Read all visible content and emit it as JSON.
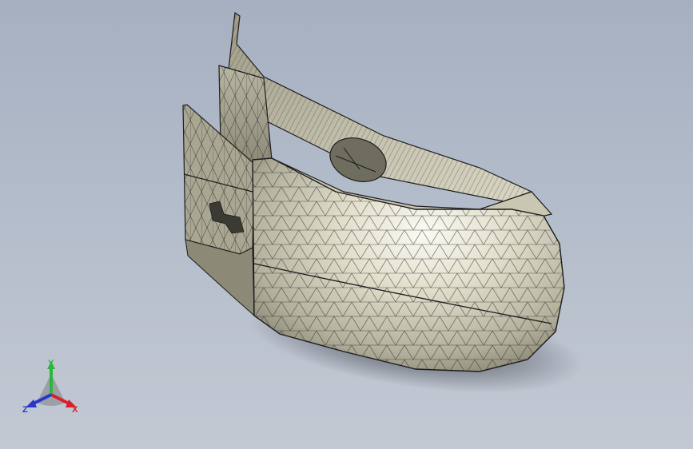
{
  "viewport": {
    "background_top": "#a6b0c1",
    "background_bottom": "#c3c9d3",
    "model_color": "#d8d5c2",
    "edge_color": "#1c1c1c"
  },
  "triad": {
    "x_label": "X",
    "y_label": "Y",
    "z_label": "Z",
    "x_color": "#d9202a",
    "y_color": "#2fb43c",
    "z_color": "#2838c8"
  }
}
